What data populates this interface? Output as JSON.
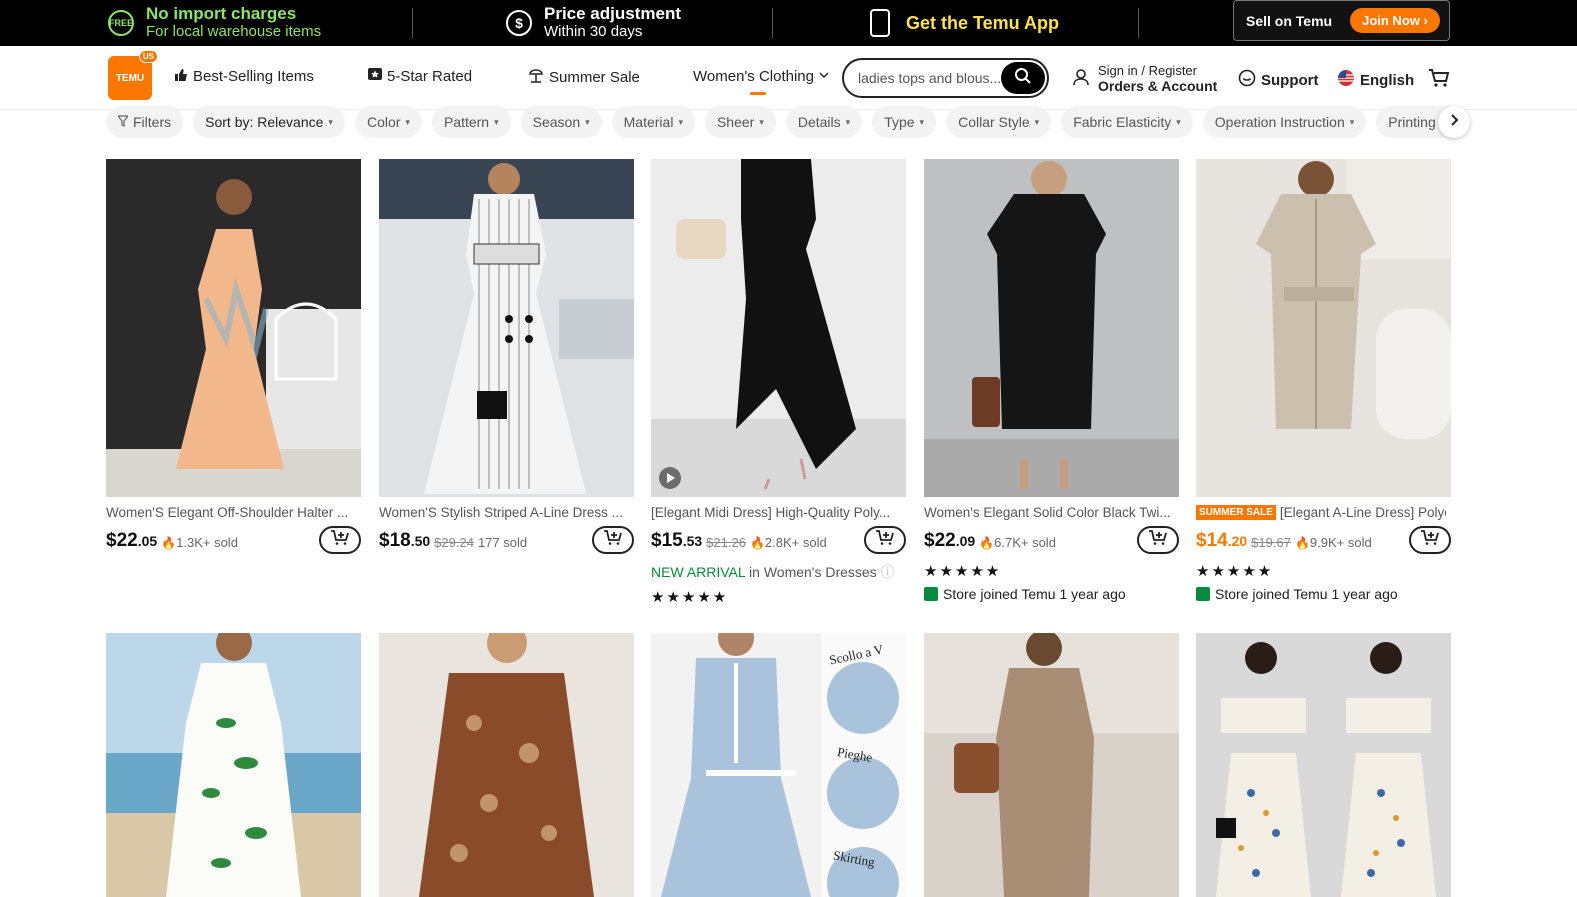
{
  "promo": {
    "import_title": "No import charges",
    "import_sub": "For local warehouse items",
    "import_icon_text": "FREE",
    "price_title": "Price adjustment",
    "price_sub": "Within 30 days",
    "price_icon_text": "$",
    "app": "Get the Temu App",
    "sell": "Sell on Temu",
    "join": "Join Now ›"
  },
  "header": {
    "logo_text": "TEMU",
    "logo_badge": "US",
    "nav": [
      {
        "label": "Best-Selling Items",
        "icon": "thumbs-up-icon"
      },
      {
        "label": "5-Star Rated",
        "icon": "star-icon"
      },
      {
        "label": "Summer Sale",
        "icon": "beach-icon"
      },
      {
        "label": "Women's Clothing",
        "icon": "chevron-down-icon"
      }
    ],
    "search_value": "ladies tops and blous...",
    "signin": "Sign in / Register",
    "orders": "Orders & Account",
    "support": "Support",
    "language": "English"
  },
  "filters": [
    {
      "label": "Filters",
      "icon": "filter-icon"
    },
    {
      "label": "Sort by: Relevance"
    },
    {
      "label": "Color"
    },
    {
      "label": "Pattern"
    },
    {
      "label": "Season"
    },
    {
      "label": "Material"
    },
    {
      "label": "Sheer"
    },
    {
      "label": "Details"
    },
    {
      "label": "Type"
    },
    {
      "label": "Collar Style"
    },
    {
      "label": "Fabric Elasticity"
    },
    {
      "label": "Operation Instruction"
    },
    {
      "label": "Printing Ty"
    }
  ],
  "products": [
    {
      "title": "Women'S Elegant Off-Shoulder Halter ...",
      "price_int": "$22",
      "price_dec": ".05",
      "old": "",
      "sold": "1.3K+ sold"
    },
    {
      "title": "Women'S Stylish Striped A-Line Dress ...",
      "price_int": "$18",
      "price_dec": ".50",
      "old": "$29.24",
      "sold": "177 sold"
    },
    {
      "title": "[Elegant Midi Dress] High-Quality Poly...",
      "price_int": "$15",
      "price_dec": ".53",
      "old": "$21.26",
      "sold": "2.8K+ sold",
      "badge_label": "NEW ARRIVAL",
      "badge_context": "in Women's Dresses",
      "stars": "★★★★★"
    },
    {
      "title": "Women's Elegant Solid Color Black Twi...",
      "price_int": "$22",
      "price_dec": ".09",
      "old": "",
      "sold": "6.7K+ sold",
      "stars": "★★★★★",
      "store": "Store joined Temu 1 year ago"
    },
    {
      "title": "[Elegant A-Line Dress] Polye...",
      "tag": "SUMMER SALE",
      "price_int": "$14",
      "price_dec": ".20",
      "old": "$19.67",
      "sold": "9.9K+ sold",
      "stars": "★★★★★",
      "store": "Store joined Temu 1 year ago"
    }
  ],
  "detail_labels": {
    "a": "Scollo a V",
    "b": "Pieghe",
    "c": "Skirting"
  },
  "colors": {
    "accent": "#fb7701",
    "promo_green": "#8fe36b",
    "promo_yellow": "#ffe14d"
  }
}
